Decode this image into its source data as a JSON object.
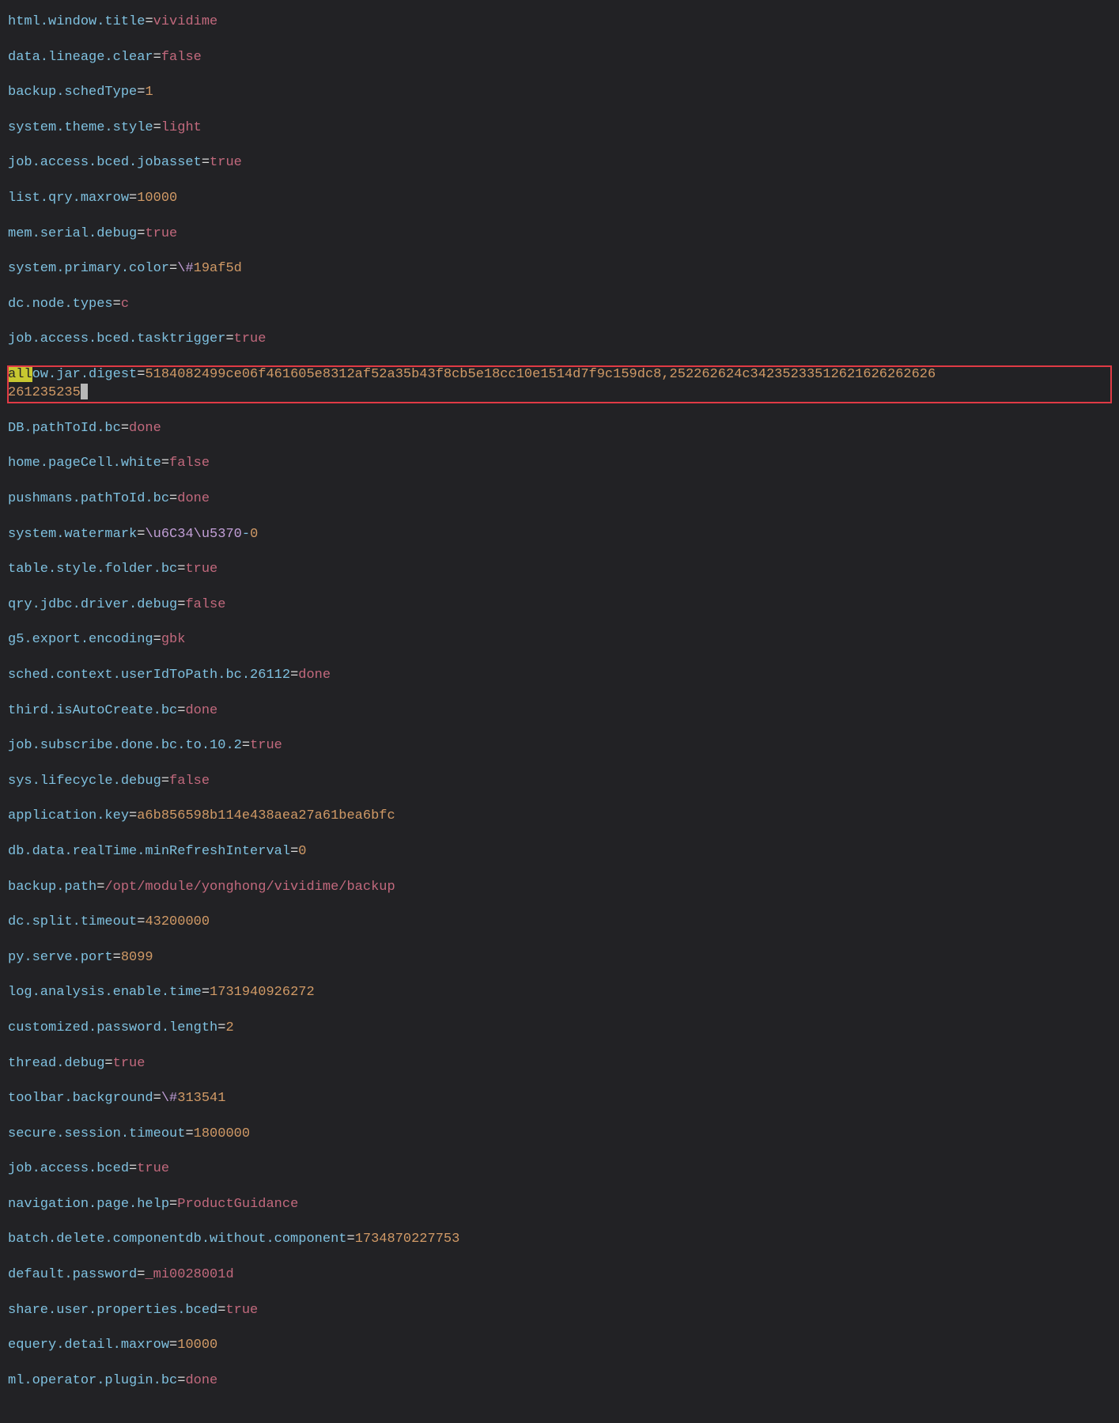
{
  "lines": [
    {
      "key": "html.window.title",
      "value": "vividime",
      "vtype": "str"
    },
    {
      "key": "data.lineage.clear",
      "value": "false",
      "vtype": "bool"
    },
    {
      "key": "backup.schedType",
      "value": "1",
      "vtype": "num"
    },
    {
      "key": "system.theme.style",
      "value": "light",
      "vtype": "str"
    },
    {
      "key": "job.access.bced.jobasset",
      "value": "true",
      "vtype": "bool"
    },
    {
      "key": "list.qry.maxrow",
      "value": "10000",
      "vtype": "num"
    },
    {
      "key": "mem.serial.debug",
      "value": "true",
      "vtype": "bool"
    },
    {
      "key": "system.primary.color",
      "value": "\\#19af5d",
      "vtype": "hex"
    },
    {
      "key": "dc.node.types",
      "value": "c",
      "vtype": "str"
    },
    {
      "key": "job.access.bced.tasktrigger",
      "value": "true",
      "vtype": "bool"
    },
    {
      "key": "allow.jar.digest",
      "hl": "all",
      "keyrest": "ow.jar.digest",
      "value": "5184082499ce06f461605e8312af52a35b43f8cb5e18cc10e1514d7f9c159dc8,252262624c34235233512621626262626",
      "value2": "261235235",
      "vtype": "num",
      "boxed": true,
      "cursor": true
    },
    {
      "key": "DB.pathToId.bc",
      "value": "done",
      "vtype": "str"
    },
    {
      "key": "home.pageCell.white",
      "value": "false",
      "vtype": "bool"
    },
    {
      "key": "pushmans.pathToId.bc",
      "value": "done",
      "vtype": "str"
    },
    {
      "key": "system.watermark",
      "value_esc": "\\u6C34\\u5370",
      "value_dash": "-",
      "value_zero": "0",
      "vtype": "esc"
    },
    {
      "key": "table.style.folder.bc",
      "value": "true",
      "vtype": "bool"
    },
    {
      "key": "qry.jdbc.driver.debug",
      "value": "false",
      "vtype": "bool"
    },
    {
      "key": "g5.export.encoding",
      "value": "gbk",
      "vtype": "str"
    },
    {
      "key": "sched.context.userIdToPath.bc.26112",
      "value": "done",
      "vtype": "str"
    },
    {
      "key": "third.isAutoCreate.bc",
      "value": "done",
      "vtype": "str"
    },
    {
      "key": "job.subscribe.done.bc.to.10.2",
      "value": "true",
      "vtype": "bool"
    },
    {
      "key": "sys.lifecycle.debug",
      "value": "false",
      "vtype": "bool"
    },
    {
      "key": "application.key",
      "value": "a6b856598b114e438aea27a61bea6bfc",
      "vtype": "num"
    },
    {
      "key": "db.data.realTime.minRefreshInterval",
      "value": "0",
      "vtype": "num"
    },
    {
      "key": "backup.path",
      "value": "/opt/module/yonghong/vividime/backup",
      "vtype": "str"
    },
    {
      "key": "dc.split.timeout",
      "value": "43200000",
      "vtype": "num"
    },
    {
      "key": "py.serve.port",
      "value": "8099",
      "vtype": "num"
    },
    {
      "key": "log.analysis.enable.time",
      "value": "1731940926272",
      "vtype": "num"
    },
    {
      "key": "customized.password.length",
      "value": "2",
      "vtype": "num"
    },
    {
      "key": "thread.debug",
      "value": "true",
      "vtype": "bool"
    },
    {
      "key": "toolbar.background",
      "value": "\\#313541",
      "vtype": "hex"
    },
    {
      "key": "secure.session.timeout",
      "value": "1800000",
      "vtype": "num"
    },
    {
      "key": "job.access.bced",
      "value": "true",
      "vtype": "bool"
    },
    {
      "key": "navigation.page.help",
      "value": "ProductGuidance",
      "vtype": "str"
    },
    {
      "key": "batch.delete.componentdb.without.component",
      "value": "1734870227753",
      "vtype": "num"
    },
    {
      "key": "default.password",
      "value": "_mi0028001d",
      "vtype": "str"
    },
    {
      "key": "share.user.properties.bced",
      "value": "true",
      "vtype": "bool"
    },
    {
      "key": "equery.detail.maxrow",
      "value": "10000",
      "vtype": "num"
    },
    {
      "key": "ml.operator.plugin.bc",
      "value": "done",
      "vtype": "str"
    }
  ]
}
